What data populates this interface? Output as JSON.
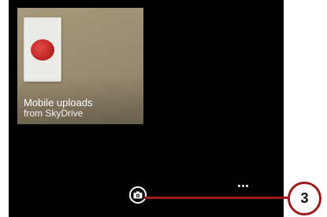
{
  "album": {
    "title": "Mobile uploads",
    "subtitle": "from SkyDrive"
  },
  "app_bar": {
    "camera_icon": "camera-icon",
    "more_icon": "more-ellipsis-icon"
  },
  "callout": {
    "number": "3",
    "color": "#9a1c1c"
  },
  "colors": {
    "screen_background": "#000000",
    "switch_red": "#c32928"
  }
}
